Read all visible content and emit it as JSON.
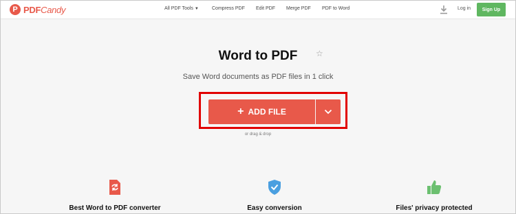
{
  "header": {
    "logo_mark": "P",
    "logo_text_bold": "PDF",
    "logo_text_rest": "Candy",
    "nav": [
      {
        "label": "All PDF Tools"
      },
      {
        "label": "Compress PDF"
      },
      {
        "label": "Edit PDF"
      },
      {
        "label": "Merge PDF"
      },
      {
        "label": "PDF to Word"
      }
    ],
    "login": "Log in",
    "signup": "Sign Up"
  },
  "main": {
    "title": "Word to PDF",
    "subtitle": "Save Word documents as PDF files in 1 click",
    "add_file": "ADD FILE",
    "drag_drop": "or drag & drop"
  },
  "features": [
    {
      "label": "Best Word to PDF converter",
      "icon": "convert-icon"
    },
    {
      "label": "Easy conversion",
      "icon": "shield-check-icon"
    },
    {
      "label": "Files' privacy protected",
      "icon": "thumbs-up-icon"
    }
  ],
  "colors": {
    "accent": "#e8594a",
    "signup": "#5fb760",
    "highlight": "#e10000",
    "shield": "#4a9fe0",
    "thumb": "#6cc070"
  }
}
